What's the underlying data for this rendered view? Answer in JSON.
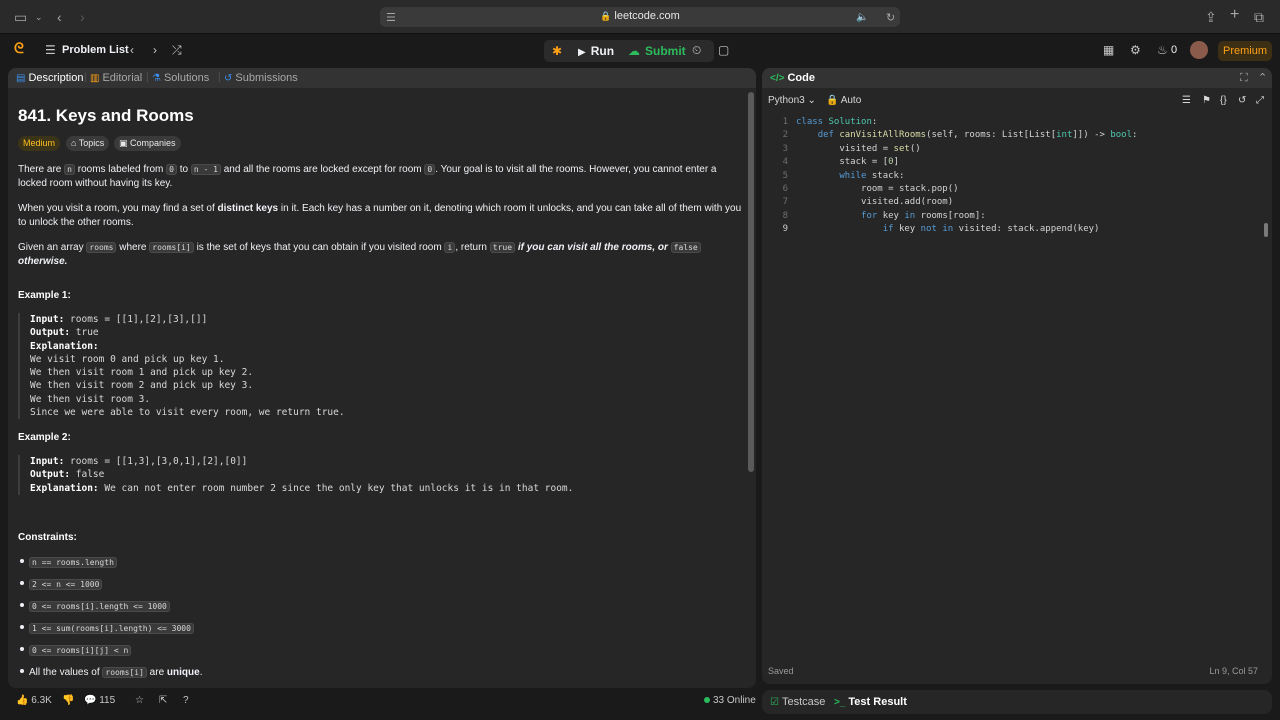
{
  "browser": {
    "url": "leetcode.com"
  },
  "nav": {
    "problem_list": "Problem List",
    "run": "Run",
    "submit": "Submit",
    "streak": "0",
    "premium": "Premium"
  },
  "left_tabs": {
    "description": "Description",
    "editorial": "Editorial",
    "solutions": "Solutions",
    "submissions": "Submissions"
  },
  "problem": {
    "title": "841. Keys and Rooms",
    "difficulty": "Medium",
    "topics": "Topics",
    "companies": "Companies",
    "p1": {
      "a": "There are ",
      "c1": "n",
      "b": " rooms labeled from ",
      "c2": "0",
      "c": " to ",
      "c3": "n - 1",
      "d": " and all the rooms are locked except for room ",
      "c4": "0",
      "e": ". Your goal is to visit all the rooms. However, you cannot enter a locked room without having its key."
    },
    "p2": {
      "a": "When you visit a room, you may find a set of ",
      "bold": "distinct keys",
      "b": " in it. Each key has a number on it, denoting which room it unlocks, and you can take all of them with you to unlock the other rooms."
    },
    "p3": {
      "a": "Given an array ",
      "c1": "rooms",
      "b": " where ",
      "c2": "rooms[i]",
      "c": " is the set of keys that you can obtain if you visited room ",
      "c3": "i",
      "d": ", return ",
      "c4": "true",
      "e1": " if you can visit ",
      "e2": "all",
      "e3": " the rooms, or ",
      "c5": "false",
      "f": " otherwise."
    },
    "example1_title": "Example 1:",
    "example1": {
      "input_label": "Input:",
      "input": " rooms = [[1],[2],[3],[]]",
      "output_label": "Output:",
      "output": " true",
      "explanation_label": "Explanation:",
      "lines": [
        "We visit room 0 and pick up key 1.",
        "We then visit room 1 and pick up key 2.",
        "We then visit room 2 and pick up key 3.",
        "We then visit room 3.",
        "Since we were able to visit every room, we return true."
      ]
    },
    "example2_title": "Example 2:",
    "example2": {
      "input_label": "Input:",
      "input": " rooms = [[1,3],[3,0,1],[2],[0]]",
      "output_label": "Output:",
      "output": " false",
      "explanation_label": "Explanation:",
      "explanation": " We can not enter room number 2 since the only key that unlocks it is in that room."
    },
    "constraints_title": "Constraints:",
    "constraints": [
      "n == rooms.length",
      "2 <= n <= 1000",
      "0 <= rooms[i].length <= 1000",
      "1 <= sum(rooms[i].length) <= 3000",
      "0 <= rooms[i][j] < n"
    ],
    "last_constraint": {
      "a": "All the values of ",
      "code": "rooms[i]",
      "b": " are ",
      "bold": "unique",
      "c": "."
    }
  },
  "footer": {
    "likes": "6.3K",
    "comments": "115",
    "online": "33 Online"
  },
  "editor": {
    "tab_title": "Code",
    "language": "Python3",
    "mode": "Auto",
    "line_numbers": [
      "1",
      "2",
      "3",
      "4",
      "5",
      "6",
      "7",
      "8",
      "9"
    ],
    "status": "Saved",
    "position": "Ln 9, Col 57"
  },
  "bottom_tabs": {
    "testcase": "Testcase",
    "test_result": "Test Result"
  },
  "colors": {
    "accent": "#ffa116",
    "submit_green": "#2cbb5d",
    "medium": "#ffc01e"
  }
}
